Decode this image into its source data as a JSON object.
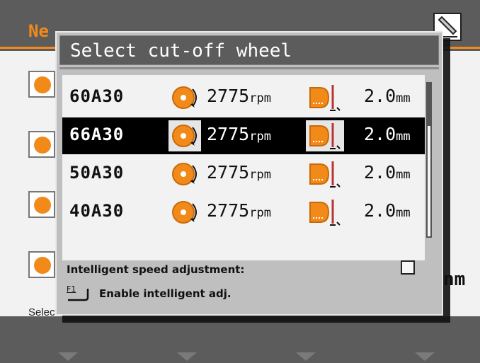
{
  "background": {
    "title": "Ne",
    "status_text": "Select cut-off wheel",
    "unit_fragment": "nm"
  },
  "dialog": {
    "title": "Select cut-off wheel",
    "rows": [
      {
        "code": "60A30",
        "rpm": "2775",
        "rpm_unit": "rpm",
        "size": "2.0",
        "size_unit": "mm",
        "selected": false
      },
      {
        "code": "66A30",
        "rpm": "2775",
        "rpm_unit": "rpm",
        "size": "2.0",
        "size_unit": "mm",
        "selected": true
      },
      {
        "code": "50A30",
        "rpm": "2775",
        "rpm_unit": "rpm",
        "size": "2.0",
        "size_unit": "mm",
        "selected": false
      },
      {
        "code": "40A30",
        "rpm": "2775",
        "rpm_unit": "rpm",
        "size": "2.0",
        "size_unit": "mm",
        "selected": false
      }
    ],
    "intelligent_speed": {
      "label": "Intelligent speed adjustment:",
      "checked": false
    },
    "f1": {
      "key": "F1",
      "label": "Enable intelligent adj."
    }
  },
  "icons": {
    "wheel": "cutoff-wheel-icon",
    "tool": "wheel-depth-icon",
    "corner": "pen-edit-icon"
  },
  "colors": {
    "accent": "#f28a1a",
    "header": "#5c5c5c",
    "selection": "#000000"
  }
}
